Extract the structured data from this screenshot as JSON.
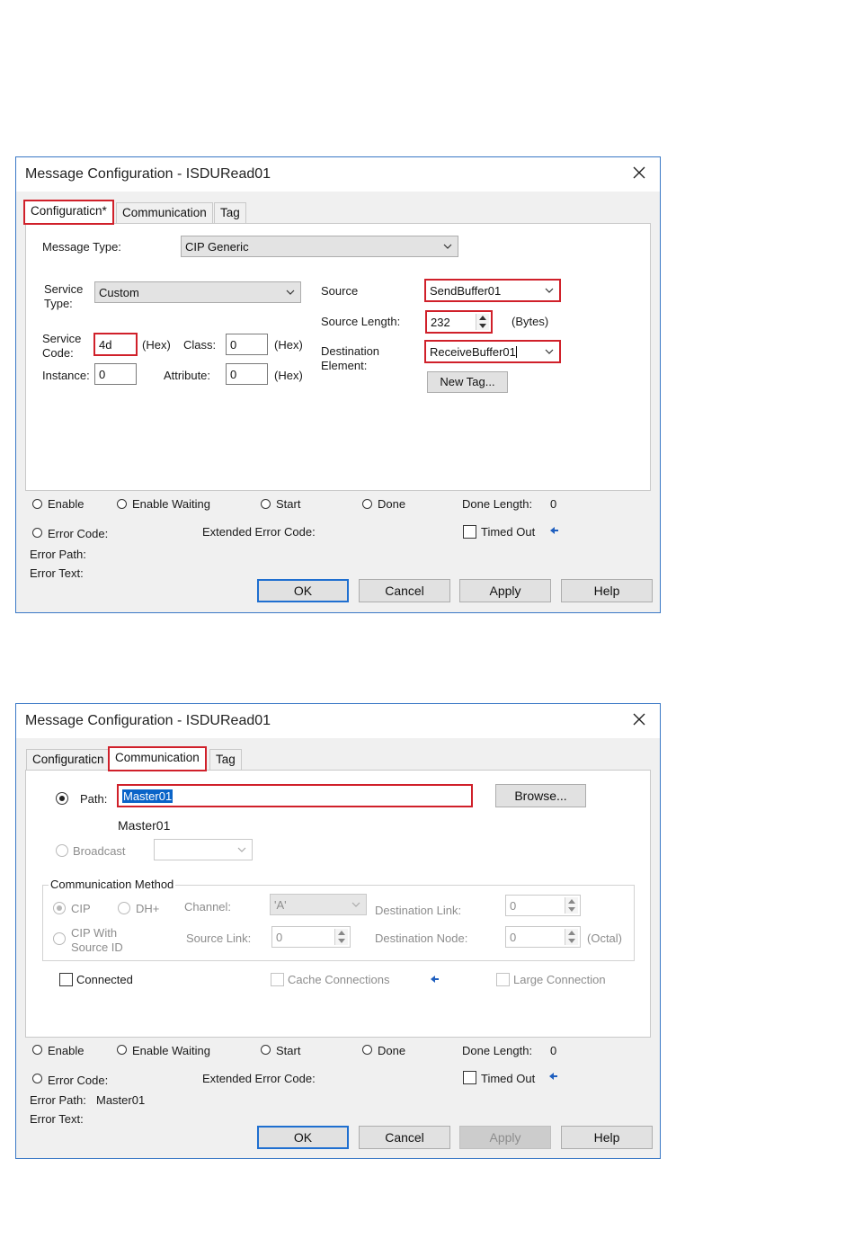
{
  "dialog1": {
    "title": "Message Configuration - ISDURead01",
    "tabs": {
      "configuration": "Configuraticn*",
      "communication": "Communication",
      "tag": "Tag"
    },
    "message_type_label": "Message Type:",
    "message_type_value": "CIP Generic",
    "service_type_label": "Service\nType:",
    "service_type_value": "Custom",
    "service_code_label": "Service\nCode:",
    "service_code_value": "4d",
    "hex_label": "(Hex)",
    "class_label": "Class:",
    "class_value": "0",
    "instance_label": "Instance:",
    "instance_value": "0",
    "attribute_label": "Attribute:",
    "attribute_value": "0",
    "source_label": "Source",
    "source_value": "SendBuffer01",
    "source_length_label": "Source Length:",
    "source_length_value": "232",
    "bytes_label": "(Bytes)",
    "destination_label": "Destination\nElement:",
    "destination_value": "ReceiveBuffer01",
    "new_tag_button": "New Tag..."
  },
  "dialog2": {
    "title": "Message Configuration - ISDURead01",
    "tabs": {
      "configuration": "Configuraticn",
      "communication": "Communication",
      "tag": "Tag"
    },
    "path_label": "Path:",
    "path_value": "Master01",
    "browse_button": "Browse...",
    "path_display": "Master01",
    "broadcast_label": "Broadcast",
    "comm_method_title": "Communication Method",
    "cip_label": "CIP",
    "dhplus_label": "DH+",
    "channel_label": "Channel:",
    "channel_value": "'A'",
    "destination_link_label": "Destination Link:",
    "destination_link_value": "0",
    "cip_with_source_id_label": "CIP With\nSource ID",
    "source_link_label": "Source Link:",
    "source_link_value": "0",
    "destination_node_label": "Destination Node:",
    "destination_node_value": "0",
    "octal_label": "(Octal)",
    "connected_label": "Connected",
    "cache_connections_label": "Cache Connections",
    "large_connection_label": "Large Connection",
    "error_path_value": "Master01"
  },
  "status": {
    "enable": "Enable",
    "enable_waiting": "Enable Waiting",
    "start": "Start",
    "done": "Done",
    "done_length_label": "Done Length:",
    "done_length_value": "0",
    "error_code_label": "Error Code:",
    "extended_error_code_label": "Extended Error Code:",
    "timed_out_label": "Timed Out",
    "error_path_label": "Error Path:",
    "error_text_label": "Error Text:"
  },
  "buttons": {
    "ok": "OK",
    "cancel": "Cancel",
    "apply": "Apply",
    "help": "Help"
  },
  "colors": {
    "highlight": "#d0202a",
    "selection": "#0a64c8",
    "default_button_border": "#1f6fd0"
  }
}
